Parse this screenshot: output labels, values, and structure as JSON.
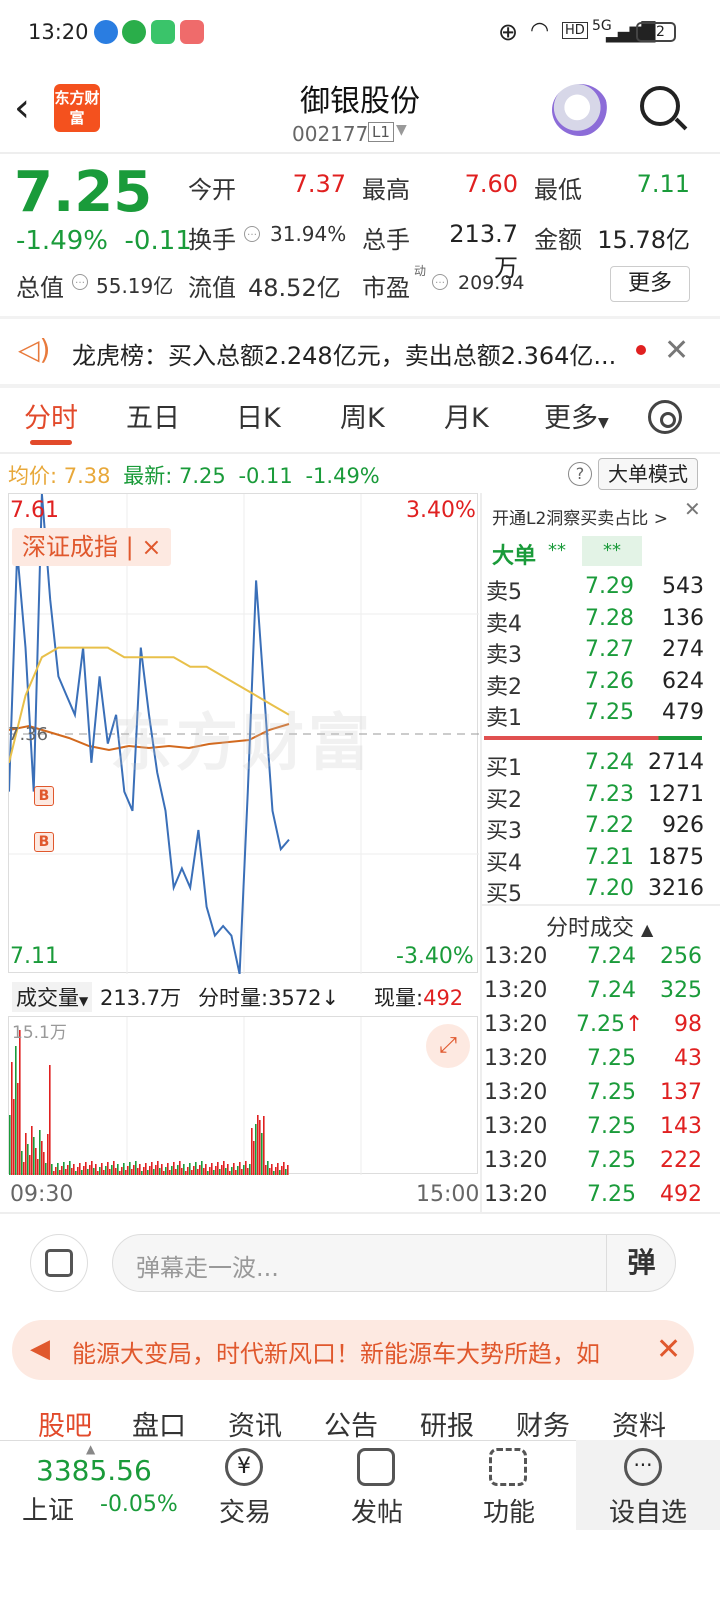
{
  "status": {
    "time": "13:20",
    "battery": "92",
    "network": "5G"
  },
  "header": {
    "title": "御银股份",
    "code": "002177",
    "level": "L1",
    "logo_text": "东方财富"
  },
  "quote": {
    "price": "7.25",
    "change_pct": "-1.49%",
    "change": "-0.11",
    "open_label": "今开",
    "open": "7.37",
    "high_label": "最高",
    "high": "7.60",
    "low_label": "最低",
    "low": "7.11",
    "turnover_label": "换手",
    "turnover": "31.94%",
    "volume_label": "总手",
    "volume": "213.7万",
    "amount_label": "金额",
    "amount": "15.78亿",
    "mktcap_label": "总值",
    "mktcap": "55.19亿",
    "float_label": "流值",
    "float": "48.52亿",
    "pe_label": "市盈",
    "pe_sup": "动",
    "pe": "209.94",
    "more": "更多"
  },
  "news": {
    "text": "龙虎榜：买入总额2.248亿元，卖出总额2.364亿..."
  },
  "tabs": {
    "t1": "分时",
    "t2": "五日",
    "t3": "日K",
    "t4": "周K",
    "t5": "月K",
    "t6": "更多"
  },
  "avg": {
    "label": "均价:",
    "value": "7.38",
    "latest_label": "最新:",
    "latest": "7.25",
    "chg": "-0.11",
    "pct": "-1.49%",
    "mode": "大单模式"
  },
  "chart": {
    "ymax": "7.61",
    "ymin": "7.11",
    "pmax": "3.40%",
    "pmin": "-3.40%",
    "mid": "7.36",
    "index_chip": "深证成指 | ×",
    "watermark": "东方财富",
    "vol_label": "成交量",
    "vol_total": "213.7万",
    "vol_period": "分时量:3572↓",
    "vol_now_label": "现量:",
    "vol_now": "492",
    "vol_max": "15.1万",
    "t_start": "09:30",
    "t_end": "15:00"
  },
  "chart_data": {
    "type": "line",
    "series": [
      {
        "name": "价格",
        "values": [
          7.3,
          7.55,
          7.45,
          7.3,
          7.61,
          7.5,
          7.42,
          7.4,
          7.38,
          7.45,
          7.33,
          7.42,
          7.35,
          7.38,
          7.3,
          7.28,
          7.45,
          7.38,
          7.32,
          7.28,
          7.2,
          7.22,
          7.2,
          7.26,
          7.18,
          7.15,
          7.16,
          7.15,
          7.11,
          7.3,
          7.52,
          7.4,
          7.28,
          7.24,
          7.25
        ]
      },
      {
        "name": "均价",
        "values": [
          7.33,
          7.4,
          7.44,
          7.45,
          7.45,
          7.45,
          7.45,
          7.44,
          7.44,
          7.44,
          7.44,
          7.43,
          7.43,
          7.42,
          7.41,
          7.4,
          7.39,
          7.38
        ]
      }
    ],
    "ylim": [
      7.11,
      7.61
    ]
  },
  "orderbook": {
    "link": "开通L2洞察买卖占比 >",
    "big_label": "大单",
    "big_a": "**",
    "big_b": "**",
    "asks": [
      {
        "n": "卖5",
        "p": "7.29",
        "v": "543"
      },
      {
        "n": "卖4",
        "p": "7.28",
        "v": "136"
      },
      {
        "n": "卖3",
        "p": "7.27",
        "v": "274"
      },
      {
        "n": "卖2",
        "p": "7.26",
        "v": "624"
      },
      {
        "n": "卖1",
        "p": "7.25",
        "v": "479"
      }
    ],
    "bids": [
      {
        "n": "买1",
        "p": "7.24",
        "v": "2714"
      },
      {
        "n": "买2",
        "p": "7.23",
        "v": "1271"
      },
      {
        "n": "买3",
        "p": "7.22",
        "v": "926"
      },
      {
        "n": "买4",
        "p": "7.21",
        "v": "1875"
      },
      {
        "n": "买5",
        "p": "7.20",
        "v": "3216"
      }
    ],
    "tx_title": "分时成交",
    "trades": [
      {
        "t": "13:20",
        "p": "7.24",
        "v": "256"
      },
      {
        "t": "13:20",
        "p": "7.24",
        "v": "325"
      },
      {
        "t": "13:20",
        "p": "7.25↑",
        "v": "98"
      },
      {
        "t": "13:20",
        "p": "7.25",
        "v": "43"
      },
      {
        "t": "13:20",
        "p": "7.25",
        "v": "137"
      },
      {
        "t": "13:20",
        "p": "7.25",
        "v": "143"
      },
      {
        "t": "13:20",
        "p": "7.25",
        "v": "222"
      },
      {
        "t": "13:20",
        "p": "7.25",
        "v": "492"
      }
    ]
  },
  "danmaku": {
    "placeholder": "弹幕走一波...",
    "btn": "弹"
  },
  "promo": {
    "text": "能源大变局，时代新风口！新能源车大势所趋，如"
  },
  "subtabs": {
    "s1": "股吧",
    "s2": "盘口",
    "s3": "资讯",
    "s4": "公告",
    "s5": "研报",
    "s6": "财务",
    "s7": "资料"
  },
  "bottom": {
    "index_value": "3385.56",
    "index_name": "上证",
    "index_pct": "-0.05%",
    "trade": "交易",
    "post": "发帖",
    "func": "功能",
    "watch": "设自选"
  },
  "colors": {
    "up": "#e02020",
    "down": "#1a9b3a",
    "accent": "#e24a2b",
    "price_line": "#3a6fb8",
    "avg_line": "#e8c04a"
  }
}
